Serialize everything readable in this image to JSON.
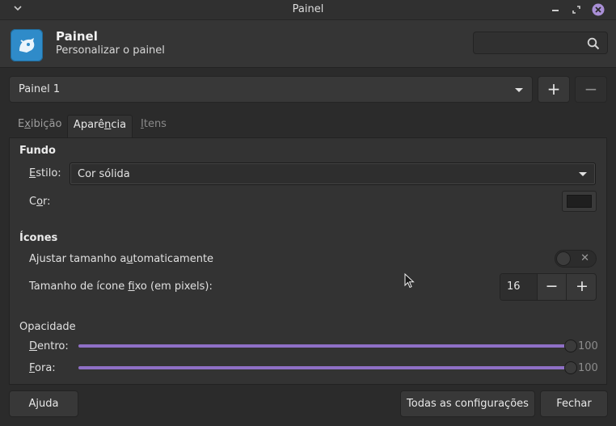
{
  "window": {
    "title": "Painel",
    "menu_icon": "chevron-down-icon",
    "buttons": [
      "minimize-icon",
      "maximize-icon",
      "close-icon"
    ],
    "close_color": "#a98fd6"
  },
  "header": {
    "title": "Painel",
    "subtitle": "Personalizar o painel",
    "search_placeholder": ""
  },
  "panel_selector": {
    "value": "Painel 1",
    "add_label": "+",
    "remove_label": "−"
  },
  "tabs": [
    {
      "pre": "E",
      "accel": "x",
      "post": "ibição",
      "active": false
    },
    {
      "pre": "Aparê",
      "accel": "n",
      "post": "cia",
      "active": true
    },
    {
      "pre": "",
      "accel": "I",
      "post": "tens",
      "active": false
    }
  ],
  "background": {
    "heading": "Fundo",
    "style_label": {
      "accel": "E",
      "rest": "stilo:"
    },
    "style_value": "Cor sólida",
    "color_label": {
      "pre": "C",
      "accel": "o",
      "post": "r:"
    },
    "color_value": "#1f1f1f"
  },
  "icons": {
    "heading": "Ícones",
    "auto_size": {
      "pre": "Ajustar tamanho a",
      "accel": "u",
      "post": "tomaticamente",
      "enabled": false
    },
    "fixed_size": {
      "pre": "Tamanho de ícone ",
      "accel": "f",
      "post": "ixo (em pixels):",
      "value": "16",
      "minus": "−",
      "plus": "+"
    }
  },
  "opacity": {
    "heading": "Opacidade",
    "inside": {
      "accel": "D",
      "rest": "entro:",
      "value": 100,
      "value_text": "100"
    },
    "outside": {
      "accel": "F",
      "rest": "ora:",
      "value": 100,
      "value_text": "100"
    },
    "slider_color": "#8f70c6"
  },
  "footer": {
    "help": "Ajuda",
    "all_settings": "Todas as configurações",
    "close": "Fechar"
  }
}
